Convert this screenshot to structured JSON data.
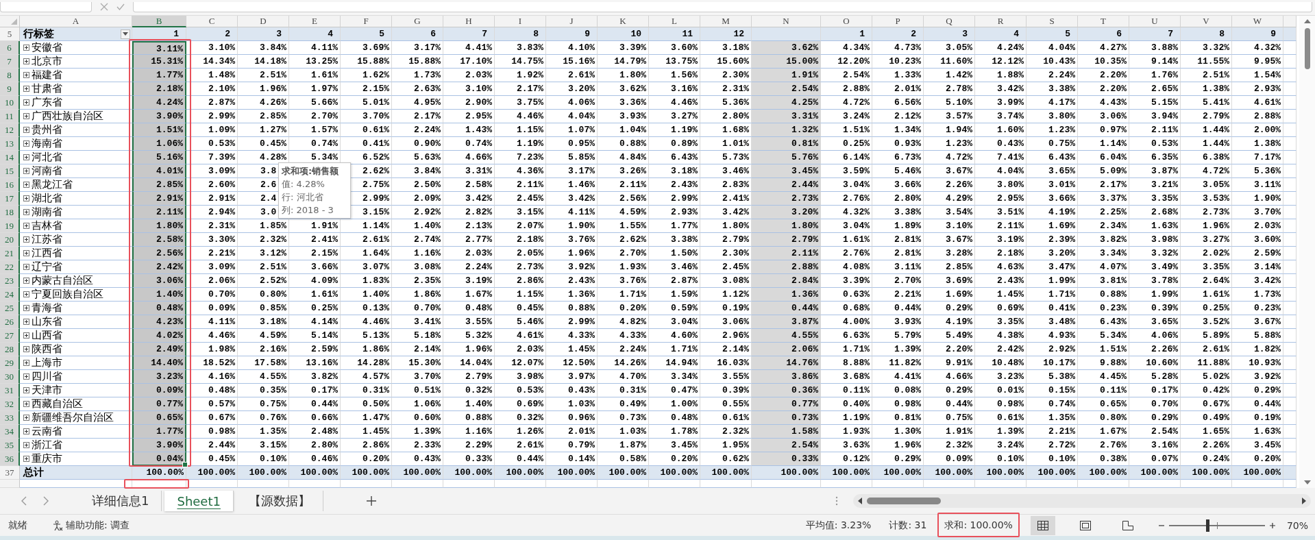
{
  "columns": [
    {
      "letter": "A",
      "selected": false,
      "shaded": false,
      "framed": false,
      "total_framed": false
    },
    {
      "letter": "B",
      "selected": true,
      "shaded": false,
      "framed": true,
      "total_framed": true
    },
    {
      "letter": "C",
      "selected": false,
      "shaded": false
    },
    {
      "letter": "D",
      "selected": false,
      "shaded": false
    },
    {
      "letter": "E",
      "selected": false,
      "shaded": false
    },
    {
      "letter": "F",
      "selected": false,
      "shaded": false
    },
    {
      "letter": "G",
      "selected": false,
      "shaded": false
    },
    {
      "letter": "H",
      "selected": false,
      "shaded": false
    },
    {
      "letter": "I",
      "selected": false,
      "shaded": false
    },
    {
      "letter": "J",
      "selected": false,
      "shaded": false
    },
    {
      "letter": "K",
      "selected": false,
      "shaded": false
    },
    {
      "letter": "L",
      "selected": false,
      "shaded": false
    },
    {
      "letter": "M",
      "selected": false,
      "shaded": false
    },
    {
      "letter": "N",
      "selected": false,
      "shaded": true
    },
    {
      "letter": "O",
      "selected": false,
      "shaded": false
    },
    {
      "letter": "P",
      "selected": false,
      "shaded": false
    },
    {
      "letter": "Q",
      "selected": false,
      "shaded": false
    },
    {
      "letter": "R",
      "selected": false,
      "shaded": false
    },
    {
      "letter": "S",
      "selected": false,
      "shaded": false
    },
    {
      "letter": "T",
      "selected": false,
      "shaded": false
    },
    {
      "letter": "U",
      "selected": false,
      "shaded": false
    },
    {
      "letter": "V",
      "selected": false,
      "shaded": false
    },
    {
      "letter": "W",
      "selected": false,
      "shaded": false
    }
  ],
  "header": {
    "number": "5",
    "label": "行标签",
    "cells": [
      "1",
      "2",
      "3",
      "4",
      "5",
      "6",
      "7",
      "8",
      "9",
      "10",
      "11",
      "12",
      null,
      "1",
      "2",
      "3",
      "4",
      "5",
      "6",
      "7",
      "8",
      "9"
    ]
  },
  "rows": [
    {
      "number": "6",
      "label": "安徽省",
      "selected": true,
      "cells": [
        "3.11%",
        "3.10%",
        "3.84%",
        "4.11%",
        "3.69%",
        "3.17%",
        "4.41%",
        "3.83%",
        "4.10%",
        "3.39%",
        "3.60%",
        "3.18%",
        "3.62%",
        "4.34%",
        "4.73%",
        "3.05%",
        "4.24%",
        "4.04%",
        "4.27%",
        "3.88%",
        "3.32%",
        "4.32%"
      ]
    },
    {
      "number": "7",
      "label": "北京市",
      "selected": true,
      "cells": [
        "15.31%",
        "14.34%",
        "14.18%",
        "13.25%",
        "15.88%",
        "15.88%",
        "17.10%",
        "14.75%",
        "15.16%",
        "14.79%",
        "13.75%",
        "15.60%",
        "15.00%",
        "12.20%",
        "10.23%",
        "11.60%",
        "12.12%",
        "10.43%",
        "10.35%",
        "9.14%",
        "11.55%",
        "9.95%"
      ]
    },
    {
      "number": "8",
      "label": "福建省",
      "selected": true,
      "cells": [
        "1.77%",
        "1.48%",
        "2.51%",
        "1.61%",
        "1.62%",
        "1.73%",
        "2.03%",
        "1.92%",
        "2.61%",
        "1.80%",
        "1.56%",
        "2.30%",
        "1.91%",
        "2.54%",
        "1.33%",
        "1.42%",
        "1.88%",
        "2.24%",
        "2.20%",
        "1.76%",
        "2.51%",
        "1.54%"
      ]
    },
    {
      "number": "9",
      "label": "甘肃省",
      "selected": true,
      "cells": [
        "2.18%",
        "2.10%",
        "1.96%",
        "1.97%",
        "2.15%",
        "2.63%",
        "3.10%",
        "2.17%",
        "3.20%",
        "3.62%",
        "3.16%",
        "2.31%",
        "2.54%",
        "2.88%",
        "2.01%",
        "2.78%",
        "3.42%",
        "3.38%",
        "2.20%",
        "2.65%",
        "1.38%",
        "2.93%"
      ]
    },
    {
      "number": "10",
      "label": "广东省",
      "selected": true,
      "cells": [
        "4.24%",
        "2.87%",
        "4.26%",
        "5.66%",
        "5.01%",
        "4.95%",
        "2.90%",
        "3.75%",
        "4.06%",
        "3.36%",
        "4.46%",
        "5.36%",
        "4.25%",
        "4.72%",
        "6.56%",
        "5.10%",
        "3.99%",
        "4.17%",
        "4.43%",
        "5.15%",
        "5.41%",
        "4.61%"
      ]
    },
    {
      "number": "11",
      "label": "广西壮族自治区",
      "selected": true,
      "cells": [
        "3.90%",
        "2.99%",
        "2.85%",
        "2.70%",
        "3.70%",
        "2.17%",
        "2.95%",
        "4.46%",
        "4.04%",
        "3.93%",
        "3.27%",
        "2.80%",
        "3.31%",
        "3.24%",
        "2.12%",
        "3.57%",
        "3.74%",
        "3.80%",
        "3.06%",
        "3.94%",
        "2.79%",
        "2.88%"
      ]
    },
    {
      "number": "12",
      "label": "贵州省",
      "selected": true,
      "cells": [
        "1.51%",
        "1.09%",
        "1.27%",
        "1.57%",
        "0.61%",
        "2.24%",
        "1.43%",
        "1.15%",
        "1.07%",
        "1.04%",
        "1.19%",
        "1.68%",
        "1.32%",
        "1.51%",
        "1.34%",
        "1.94%",
        "1.60%",
        "1.23%",
        "0.97%",
        "2.11%",
        "1.44%",
        "2.00%"
      ]
    },
    {
      "number": "13",
      "label": "海南省",
      "selected": true,
      "cells": [
        "1.06%",
        "0.53%",
        "0.45%",
        "0.74%",
        "0.41%",
        "0.90%",
        "0.74%",
        "1.19%",
        "0.95%",
        "0.88%",
        "0.89%",
        "1.01%",
        "0.81%",
        "0.25%",
        "0.93%",
        "1.23%",
        "0.43%",
        "0.75%",
        "1.14%",
        "0.53%",
        "1.44%",
        "1.38%"
      ]
    },
    {
      "number": "14",
      "label": "河北省",
      "selected": true,
      "cells": [
        "5.16%",
        "7.39%",
        "4.28%",
        "5.34%",
        "6.52%",
        "5.63%",
        "4.66%",
        "7.23%",
        "5.85%",
        "4.84%",
        "6.43%",
        "5.73%",
        "5.76%",
        "6.14%",
        "6.73%",
        "4.72%",
        "7.41%",
        "6.43%",
        "6.04%",
        "6.35%",
        "6.38%",
        "7.17%"
      ]
    },
    {
      "number": "15",
      "label": "河南省",
      "selected": true,
      "cells": [
        "4.01%",
        "3.09%",
        {
          "text": "3.8",
          "cut": true
        },
        null,
        "2.62%",
        "3.84%",
        "3.31%",
        "4.36%",
        "3.17%",
        "3.26%",
        "3.18%",
        "3.46%",
        "3.45%",
        "3.59%",
        "5.46%",
        "3.67%",
        "4.04%",
        "3.65%",
        "5.09%",
        "3.87%",
        "4.72%",
        "5.36%"
      ]
    },
    {
      "number": "16",
      "label": "黑龙江省",
      "selected": true,
      "cells": [
        "2.85%",
        "2.60%",
        {
          "text": "2.6",
          "cut": true
        },
        null,
        "2.75%",
        "2.50%",
        "2.58%",
        "2.11%",
        "1.46%",
        "2.11%",
        "2.43%",
        "2.83%",
        "2.44%",
        "3.04%",
        "3.66%",
        "2.26%",
        "3.80%",
        "3.01%",
        "2.17%",
        "3.21%",
        "3.05%",
        "3.11%"
      ]
    },
    {
      "number": "17",
      "label": "湖北省",
      "selected": true,
      "cells": [
        "2.91%",
        "2.91%",
        {
          "text": "2.4",
          "cut": true
        },
        null,
        "2.99%",
        "2.09%",
        "3.42%",
        "2.45%",
        "3.42%",
        "2.56%",
        "2.99%",
        "2.41%",
        "2.73%",
        "2.76%",
        "2.80%",
        "4.29%",
        "2.95%",
        "3.66%",
        "3.37%",
        "3.35%",
        "3.53%",
        "1.90%"
      ]
    },
    {
      "number": "18",
      "label": "湖南省",
      "selected": true,
      "cells": [
        "2.11%",
        "2.94%",
        {
          "text": "3.0",
          "cut": true
        },
        null,
        "3.15%",
        "2.92%",
        "2.82%",
        "3.15%",
        "4.11%",
        "4.59%",
        "2.93%",
        "3.42%",
        "3.20%",
        "4.32%",
        "3.38%",
        "3.54%",
        "3.51%",
        "4.19%",
        "2.25%",
        "2.68%",
        "2.73%",
        "3.70%"
      ]
    },
    {
      "number": "19",
      "label": "吉林省",
      "selected": true,
      "cells": [
        "1.80%",
        "2.31%",
        "1.85%",
        "1.91%",
        "1.14%",
        "1.40%",
        "2.13%",
        "2.07%",
        "1.90%",
        "1.55%",
        "1.77%",
        "1.80%",
        "1.80%",
        "3.04%",
        "1.89%",
        "3.10%",
        "2.11%",
        "1.69%",
        "2.34%",
        "1.63%",
        "1.96%",
        "2.03%"
      ]
    },
    {
      "number": "20",
      "label": "江苏省",
      "selected": true,
      "cells": [
        "2.58%",
        "3.30%",
        "2.32%",
        "2.41%",
        "2.61%",
        "2.74%",
        "2.77%",
        "2.18%",
        "3.76%",
        "2.62%",
        "3.38%",
        "2.79%",
        "2.79%",
        "1.61%",
        "2.81%",
        "3.67%",
        "3.19%",
        "2.39%",
        "3.82%",
        "3.98%",
        "3.27%",
        "3.60%"
      ]
    },
    {
      "number": "21",
      "label": "江西省",
      "selected": true,
      "cells": [
        "2.56%",
        "2.21%",
        "3.12%",
        "2.15%",
        "1.64%",
        "1.16%",
        "2.03%",
        "2.05%",
        "1.96%",
        "2.70%",
        "1.50%",
        "2.30%",
        "2.11%",
        "2.76%",
        "2.81%",
        "3.28%",
        "2.18%",
        "3.20%",
        "3.34%",
        "3.32%",
        "2.02%",
        "2.59%"
      ]
    },
    {
      "number": "22",
      "label": "辽宁省",
      "selected": true,
      "cells": [
        "2.42%",
        "3.09%",
        "2.51%",
        "3.66%",
        "3.07%",
        "3.08%",
        "2.24%",
        "2.73%",
        "3.92%",
        "1.93%",
        "3.46%",
        "2.45%",
        "2.88%",
        "4.08%",
        "3.11%",
        "2.85%",
        "4.63%",
        "3.47%",
        "4.07%",
        "3.49%",
        "3.35%",
        "3.14%"
      ]
    },
    {
      "number": "23",
      "label": "内蒙古自治区",
      "selected": true,
      "cells": [
        "3.06%",
        "2.06%",
        "2.52%",
        "4.09%",
        "1.83%",
        "2.35%",
        "3.19%",
        "2.86%",
        "2.43%",
        "3.76%",
        "2.87%",
        "3.08%",
        "2.84%",
        "3.39%",
        "2.70%",
        "3.69%",
        "2.43%",
        "1.99%",
        "3.81%",
        "3.78%",
        "2.64%",
        "3.42%"
      ]
    },
    {
      "number": "24",
      "label": "宁夏回族自治区",
      "selected": true,
      "cells": [
        "1.40%",
        "0.70%",
        "0.80%",
        "1.61%",
        "1.40%",
        "1.86%",
        "1.67%",
        "1.15%",
        "1.36%",
        "1.71%",
        "1.59%",
        "1.12%",
        "1.36%",
        "0.63%",
        "2.21%",
        "1.69%",
        "1.45%",
        "1.71%",
        "0.88%",
        "1.99%",
        "1.61%",
        "1.73%"
      ]
    },
    {
      "number": "25",
      "label": "青海省",
      "selected": true,
      "cells": [
        "0.48%",
        "0.09%",
        "0.85%",
        "0.25%",
        "0.13%",
        "0.70%",
        "0.48%",
        "0.45%",
        "0.88%",
        "0.20%",
        "0.59%",
        "0.19%",
        "0.44%",
        "0.68%",
        "0.44%",
        "0.29%",
        "0.69%",
        "0.41%",
        "0.23%",
        "0.39%",
        "0.25%",
        "0.23%"
      ]
    },
    {
      "number": "26",
      "label": "山东省",
      "selected": true,
      "cells": [
        "4.23%",
        "4.11%",
        "3.18%",
        "4.14%",
        "4.46%",
        "3.41%",
        "3.55%",
        "5.46%",
        "2.99%",
        "4.82%",
        "3.04%",
        "3.06%",
        "3.87%",
        "4.00%",
        "3.93%",
        "4.19%",
        "3.35%",
        "3.48%",
        "6.43%",
        "3.65%",
        "3.52%",
        "3.67%"
      ]
    },
    {
      "number": "27",
      "label": "山西省",
      "selected": true,
      "cells": [
        "4.02%",
        "4.46%",
        "4.59%",
        "5.14%",
        "5.13%",
        "5.18%",
        "5.32%",
        "4.61%",
        "4.33%",
        "4.33%",
        "4.60%",
        "2.96%",
        "4.55%",
        "6.63%",
        "5.79%",
        "5.49%",
        "4.38%",
        "4.93%",
        "5.34%",
        "4.06%",
        "5.89%",
        "5.88%"
      ]
    },
    {
      "number": "28",
      "label": "陕西省",
      "selected": true,
      "cells": [
        "2.49%",
        "1.98%",
        "2.16%",
        "2.59%",
        "1.86%",
        "2.14%",
        "1.96%",
        "2.03%",
        "1.45%",
        "2.24%",
        "1.71%",
        "2.14%",
        "2.06%",
        "1.71%",
        "1.39%",
        "2.20%",
        "2.42%",
        "2.92%",
        "1.51%",
        "2.26%",
        "2.61%",
        "1.82%"
      ]
    },
    {
      "number": "29",
      "label": "上海市",
      "selected": true,
      "cells": [
        "14.40%",
        "18.52%",
        "17.58%",
        "13.16%",
        "14.28%",
        "15.30%",
        "14.04%",
        "12.07%",
        "12.50%",
        "14.26%",
        "14.94%",
        "16.03%",
        "14.76%",
        "8.88%",
        "11.82%",
        "9.91%",
        "10.48%",
        "10.17%",
        "9.88%",
        "10.60%",
        "11.88%",
        "10.93%"
      ]
    },
    {
      "number": "30",
      "label": "四川省",
      "selected": true,
      "cells": [
        "3.23%",
        "4.16%",
        "4.55%",
        "3.82%",
        "4.57%",
        "3.70%",
        "2.79%",
        "3.98%",
        "3.97%",
        "4.70%",
        "3.34%",
        "3.55%",
        "3.86%",
        "3.68%",
        "4.41%",
        "4.66%",
        "3.23%",
        "5.38%",
        "4.45%",
        "5.28%",
        "5.02%",
        "3.92%"
      ]
    },
    {
      "number": "31",
      "label": "天津市",
      "selected": true,
      "cells": [
        "0.09%",
        "0.48%",
        "0.35%",
        "0.17%",
        "0.31%",
        "0.51%",
        "0.32%",
        "0.53%",
        "0.43%",
        "0.31%",
        "0.47%",
        "0.39%",
        "0.36%",
        "0.11%",
        "0.08%",
        "0.29%",
        "0.01%",
        "0.15%",
        "0.11%",
        "0.17%",
        "0.42%",
        "0.29%"
      ]
    },
    {
      "number": "32",
      "label": "西藏自治区",
      "selected": true,
      "cells": [
        "0.77%",
        "0.57%",
        "0.75%",
        "0.44%",
        "0.50%",
        "1.06%",
        "1.40%",
        "0.69%",
        "1.03%",
        "0.49%",
        "1.00%",
        "0.55%",
        "0.77%",
        "0.40%",
        "0.98%",
        "0.44%",
        "0.98%",
        "0.74%",
        "0.65%",
        "0.70%",
        "0.67%",
        "0.44%"
      ]
    },
    {
      "number": "33",
      "label": "新疆维吾尔自治区",
      "selected": true,
      "cells": [
        "0.65%",
        "0.67%",
        "0.76%",
        "0.66%",
        "1.47%",
        "0.60%",
        "0.88%",
        "0.32%",
        "0.96%",
        "0.73%",
        "0.48%",
        "0.61%",
        "0.73%",
        "1.19%",
        "0.81%",
        "0.75%",
        "0.61%",
        "1.35%",
        "0.80%",
        "0.29%",
        "0.49%",
        "0.19%"
      ]
    },
    {
      "number": "34",
      "label": "云南省",
      "selected": true,
      "cells": [
        "1.77%",
        "0.98%",
        "1.35%",
        "2.48%",
        "1.45%",
        "1.39%",
        "1.16%",
        "1.26%",
        "2.01%",
        "1.03%",
        "1.78%",
        "2.32%",
        "1.58%",
        "1.93%",
        "1.30%",
        "1.91%",
        "1.39%",
        "2.21%",
        "1.67%",
        "2.54%",
        "1.65%",
        "1.63%"
      ]
    },
    {
      "number": "35",
      "label": "浙江省",
      "selected": true,
      "cells": [
        "3.90%",
        "2.44%",
        "3.15%",
        "2.80%",
        "2.86%",
        "2.33%",
        "2.29%",
        "2.61%",
        "0.79%",
        "1.87%",
        "3.45%",
        "1.95%",
        "2.54%",
        "3.63%",
        "1.96%",
        "2.32%",
        "3.24%",
        "2.72%",
        "2.76%",
        "3.16%",
        "2.26%",
        "3.45%"
      ]
    },
    {
      "number": "36",
      "label": "重庆市",
      "selected": true,
      "cells": [
        "0.04%",
        "0.45%",
        "0.10%",
        "0.46%",
        "0.20%",
        "0.43%",
        "0.33%",
        "0.44%",
        "0.14%",
        "0.58%",
        "0.20%",
        "0.62%",
        "0.33%",
        "0.12%",
        "0.29%",
        "0.09%",
        "0.10%",
        "0.10%",
        "0.38%",
        "0.07%",
        "0.24%",
        "0.20%"
      ]
    }
  ],
  "total": {
    "number": "37",
    "label": "总计",
    "cells": [
      "100.00%",
      "100.00%",
      "100.00%",
      "100.00%",
      "100.00%",
      "100.00%",
      "100.00%",
      "100.00%",
      "100.00%",
      "100.00%",
      "100.00%",
      "100.00%",
      "100.00%",
      "100.00%",
      "100.00%",
      "100.00%",
      "100.00%",
      "100.00%",
      "100.00%",
      "100.00%",
      "100.00%",
      "100.00%"
    ]
  },
  "tooltip": {
    "title": "求和项:销售额",
    "lines": [
      "值: 4.28%",
      "行: 河北省",
      "列: 2018 - 3"
    ]
  },
  "sheet_tabs": [
    {
      "label": "详细信息1",
      "selected": false
    },
    {
      "label": "Sheet1",
      "selected": true
    },
    {
      "label": "【源数据】",
      "selected": false
    }
  ],
  "status_bar": {
    "mode": "就绪",
    "accessibility": "辅助功能: 调查",
    "average": "平均值: 3.23%",
    "count": "计数: 31",
    "sum": {
      "text": "求和: 100.00%",
      "framed": true
    },
    "views": [
      {
        "kind": "normal",
        "selected": true
      },
      {
        "kind": "page-layout",
        "selected": false
      },
      {
        "kind": "page-break",
        "selected": false
      }
    ],
    "zoom": {
      "level": 0.4,
      "reading": "70%"
    }
  }
}
